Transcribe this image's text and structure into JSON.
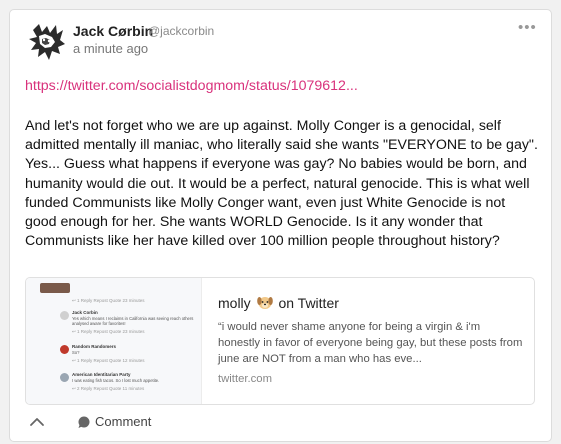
{
  "post": {
    "author_name": "Jack Cørbin",
    "author_handle": "@jackcorbin",
    "timestamp": "a minute ago",
    "more_label": "•••",
    "link_text": "https://twitter.com/socialistdogmom/status/1079612...",
    "text": "And let's not forget who we are up against. Molly Conger is a genocidal, self admitted mentally ill maniac, who literally said she wants \"EVERYONE to be gay\". Yes... Guess what happens if everyone was gay? No babies would be born, and humanity would die out. It would be a perfect, natural genocide. This is what well funded Communists like Molly Conger want, even just White Genocide is not good enough for her. She wants WORLD Genocide. Is it any wonder that Communists like her have killed over 100 million people throughout history?"
  },
  "preview": {
    "title_prefix": "molly",
    "title_emoji_icon": "dog-face-icon",
    "title_suffix": "on Twitter",
    "description": "“i would never shame anyone for being a virgin & i'm honestly in favor of everyone being gay, but these posts from june are NOT from a man who has eve...",
    "domain": "twitter.com",
    "thumbnail": {
      "rows": [
        {
          "actions": "↩ 1  Reply   Repost   Quote   23 minutes"
        },
        {
          "name": "Jack Corbin",
          "text": "Yes which means I reclaims in California was seeing reach others",
          "text2": "analysed aware for favorites!",
          "actions": "↩ 1  Reply   Repost   Quote   23 minutes"
        },
        {
          "name": "Random Randomers",
          "text": "So?",
          "actions": "↩ 1  Reply   Repost   Quote   12 minutes"
        },
        {
          "name": "American Identitarian Party",
          "text": "I was eating fish tacos. So I lost much appetite.",
          "actions": "↩ 2  Reply   Repost   Quote   11 minutes"
        }
      ]
    }
  },
  "footer": {
    "collapse_icon": "chevron-up-icon",
    "comment_label": "Comment",
    "comment_icon": "speech-bubble-icon"
  },
  "colors": {
    "link": "#d9327c",
    "card_border": "#dcdcdc",
    "background": "#f1f1f1"
  }
}
